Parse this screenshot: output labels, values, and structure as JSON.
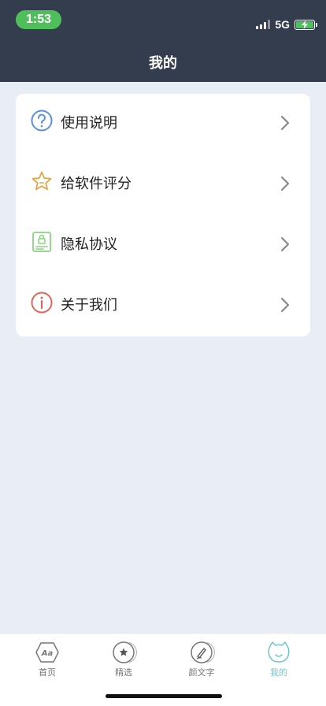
{
  "status": {
    "time": "1:53",
    "network": "5G"
  },
  "header": {
    "title": "我的"
  },
  "menu": {
    "items": [
      {
        "label": "使用说明",
        "icon": "question-circle-icon",
        "color": "#5b8fe0"
      },
      {
        "label": "给软件评分",
        "icon": "star-outline-icon",
        "color": "#e0a74a"
      },
      {
        "label": "隐私协议",
        "icon": "lock-document-icon",
        "color": "#8ad47f"
      },
      {
        "label": "关于我们",
        "icon": "info-circle-icon",
        "color": "#e0655a"
      }
    ]
  },
  "tabbar": {
    "tabs": [
      {
        "label": "首页",
        "icon": "aa-hexagon-icon"
      },
      {
        "label": "精选",
        "icon": "star-badge-icon"
      },
      {
        "label": "颜文字",
        "icon": "pen-circle-icon"
      },
      {
        "label": "我的",
        "icon": "cat-face-icon",
        "active": true
      }
    ],
    "active_color": "#6cc5cf"
  }
}
